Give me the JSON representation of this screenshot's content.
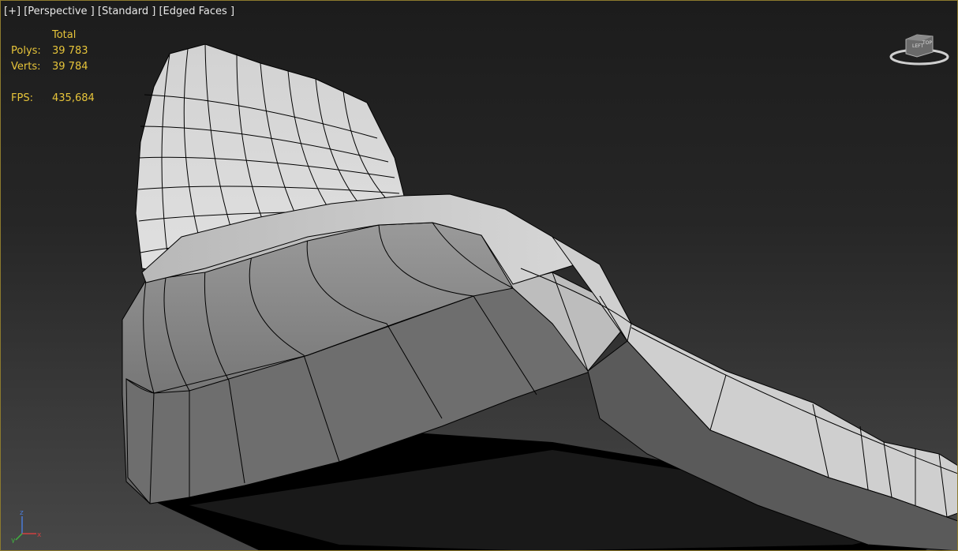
{
  "viewport": {
    "labels": [
      "[+]",
      "[Perspective ]",
      "[Standard ]",
      "[Edged Faces ]"
    ],
    "stats": {
      "header": "Total",
      "polys_label": "Polys:",
      "polys_value": "39 783",
      "verts_label": "Verts:",
      "verts_value": "39 784",
      "fps_label": "FPS:",
      "fps_value": "435,684"
    }
  },
  "viewcube": {
    "top_label": "TOP",
    "left_label": "LEFT"
  },
  "axis_tripod": {
    "x": "x",
    "y": "y",
    "z": "z"
  },
  "colors": {
    "stats_text": "#e6c43a",
    "active_border": "#8c7a2e",
    "mesh_wire": "#000000"
  }
}
